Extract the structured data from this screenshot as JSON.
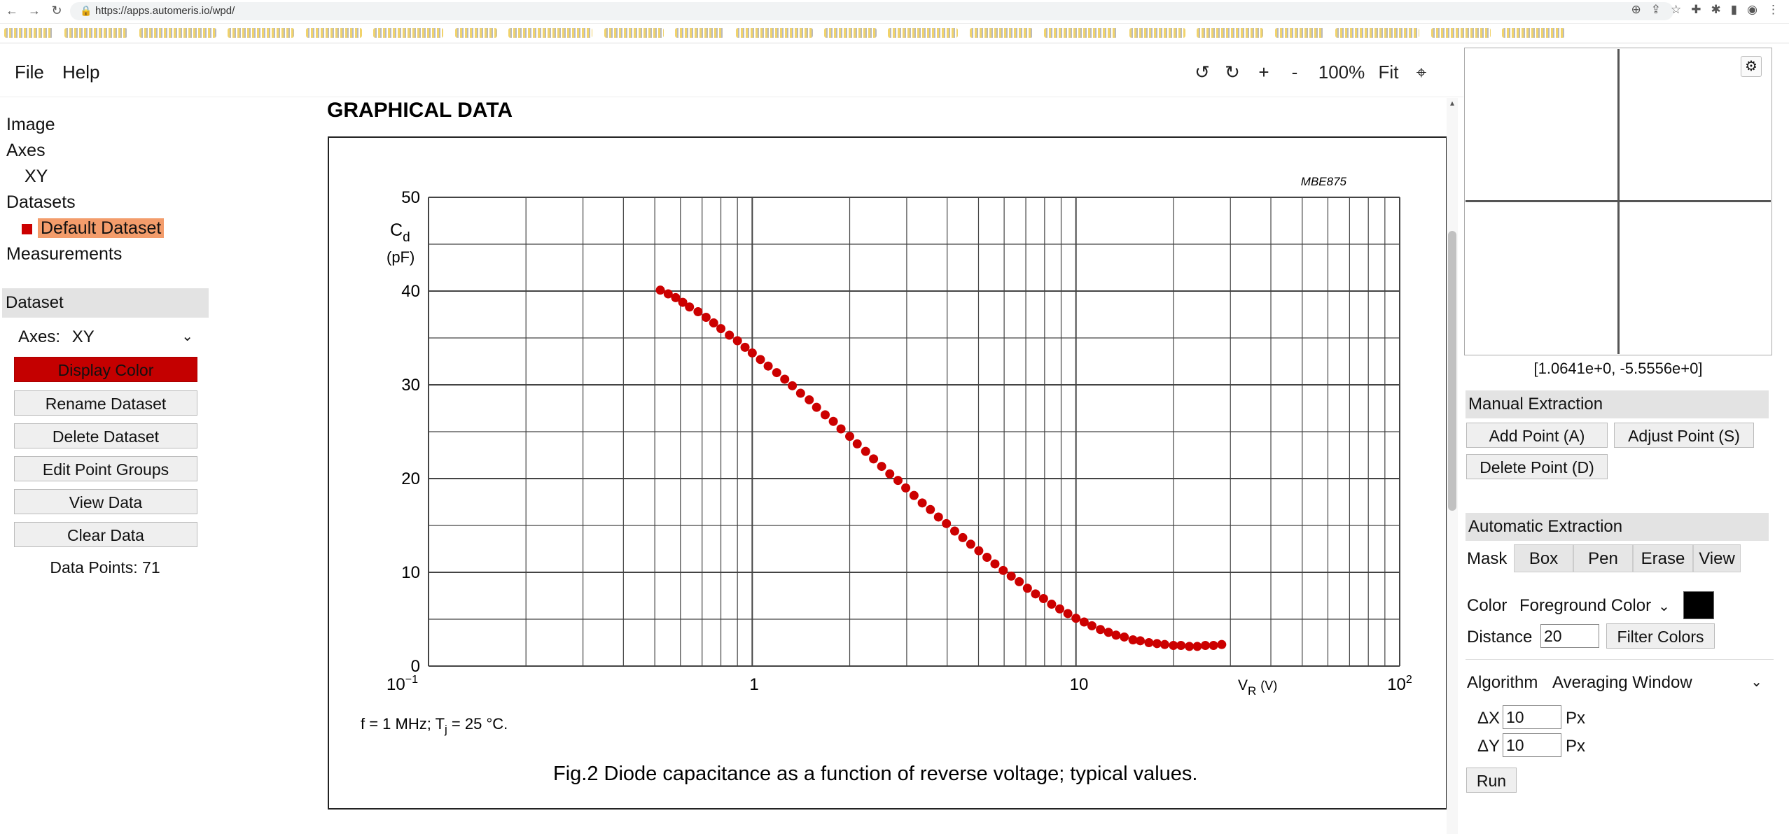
{
  "browser": {
    "url": "https://apps.automeris.io/wpd/"
  },
  "menu": {
    "file": "File",
    "help": "Help"
  },
  "toolbar": {
    "rotate_left": "↺",
    "rotate_right": "↻",
    "zoom_in": "+",
    "zoom_out": "-",
    "zoom_level": "100%",
    "fit": "Fit",
    "crosshair": "⌖"
  },
  "tree": {
    "image": "Image",
    "axes": "Axes",
    "axes_xy": "XY",
    "datasets": "Datasets",
    "default_dataset": "Default Dataset",
    "measurements": "Measurements"
  },
  "dataset_panel": {
    "title": "Dataset",
    "axes_label": "Axes:",
    "axes_value": "XY",
    "display_color": "Display Color",
    "rename": "Rename Dataset",
    "delete": "Delete Dataset",
    "edit_groups": "Edit Point Groups",
    "view_data": "View Data",
    "clear_data": "Clear Data",
    "data_points_label": "Data Points:",
    "data_points_value": "71",
    "display_color_hex": "#cc0000"
  },
  "figure": {
    "section_title": "GRAPHICAL DATA",
    "code": "MBE875",
    "ylabel_main": "C",
    "ylabel_sub": "d",
    "ylabel_unit": "(pF)",
    "xlabel_main": "V",
    "xlabel_sub": "R",
    "xlabel_unit": "(V)",
    "yticks": [
      "0",
      "10",
      "20",
      "30",
      "40",
      "50"
    ],
    "xtick_first_base": "10",
    "xtick_first_exp": "−1",
    "xtick_mid1": "1",
    "xtick_mid2": "10",
    "xtick_last_base": "10",
    "xtick_last_exp": "2",
    "condition_text": "f = 1 MHz; T",
    "condition_sub": "j",
    "condition_rest": " = 25 °C.",
    "caption": "Fig.2  Diode capacitance as a function of reverse voltage; typical values."
  },
  "chart_data": {
    "type": "scatter",
    "xscale": "log",
    "xlim": [
      0.1,
      100
    ],
    "ylim": [
      0,
      50
    ],
    "grid": true,
    "point_color": "#cc0000",
    "x": [
      0.52,
      0.55,
      0.58,
      0.61,
      0.64,
      0.68,
      0.72,
      0.76,
      0.8,
      0.85,
      0.9,
      0.95,
      1.0,
      1.06,
      1.12,
      1.19,
      1.26,
      1.33,
      1.41,
      1.5,
      1.58,
      1.68,
      1.78,
      1.88,
      2.0,
      2.11,
      2.24,
      2.37,
      2.51,
      2.66,
      2.82,
      2.98,
      3.16,
      3.35,
      3.55,
      3.76,
      3.98,
      4.22,
      4.47,
      4.73,
      5.01,
      5.31,
      5.62,
      5.96,
      6.31,
      6.68,
      7.08,
      7.5,
      7.94,
      8.41,
      8.91,
      9.44,
      10.0,
      10.6,
      11.2,
      11.9,
      12.6,
      13.3,
      14.1,
      15.0,
      15.8,
      16.8,
      17.8,
      18.8,
      20.0,
      21.1,
      22.4,
      23.7,
      25.1,
      26.6,
      28.2
    ],
    "y": [
      40.1,
      39.7,
      39.3,
      38.8,
      38.3,
      37.8,
      37.2,
      36.6,
      36.0,
      35.3,
      34.7,
      34.0,
      33.4,
      32.7,
      32.0,
      31.3,
      30.6,
      29.9,
      29.1,
      28.4,
      27.6,
      26.8,
      26.1,
      25.3,
      24.5,
      23.7,
      22.9,
      22.1,
      21.3,
      20.5,
      19.8,
      19.0,
      18.2,
      17.4,
      16.7,
      15.9,
      15.2,
      14.4,
      13.7,
      13.0,
      12.3,
      11.6,
      10.9,
      10.2,
      9.6,
      9.0,
      8.3,
      7.7,
      7.2,
      6.6,
      6.1,
      5.6,
      5.1,
      4.7,
      4.3,
      3.9,
      3.6,
      3.3,
      3.1,
      2.8,
      2.7,
      2.5,
      2.4,
      2.3,
      2.2,
      2.2,
      2.1,
      2.1,
      2.2,
      2.2,
      2.3
    ]
  },
  "right_panel": {
    "coords": "[1.0641e+0, -5.5556e+0]",
    "manual_title": "Manual Extraction",
    "add_point": "Add Point (A)",
    "adjust_point": "Adjust Point (S)",
    "delete_point": "Delete Point (D)",
    "auto_title": "Automatic Extraction",
    "mask_label": "Mask",
    "mask_box": "Box",
    "mask_pen": "Pen",
    "mask_erase": "Erase",
    "mask_view": "View",
    "color_label": "Color",
    "color_value": "Foreground Color",
    "distance_label": "Distance",
    "distance_value": "20",
    "filter_colors": "Filter Colors",
    "algorithm_label": "Algorithm",
    "algorithm_value": "Averaging Window",
    "dx_label": "ΔX",
    "dx_value": "10",
    "dy_label": "ΔY",
    "dy_value": "10",
    "px": "Px",
    "run": "Run"
  }
}
